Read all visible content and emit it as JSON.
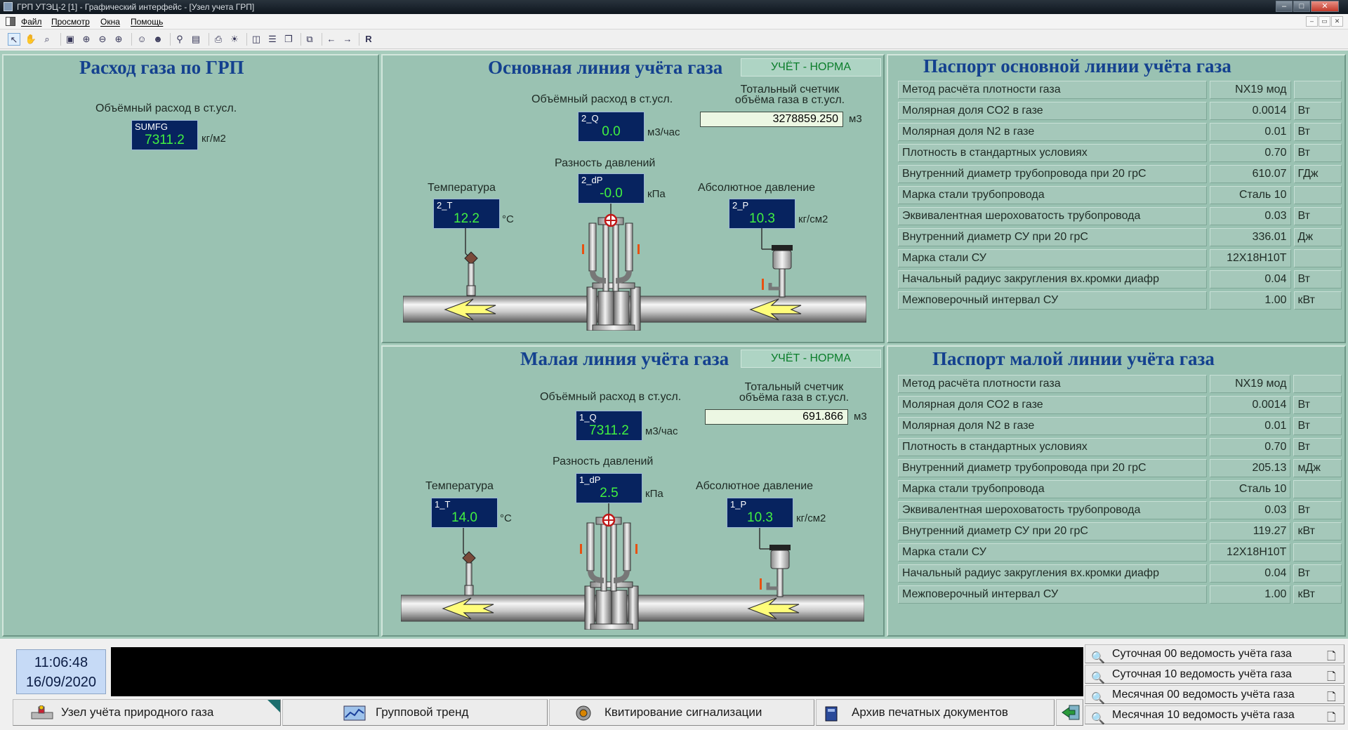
{
  "window": {
    "title": "ГРП УТЭЦ-2 [1] - Графический интерфейс - [Узел учета ГРП]",
    "btn_min": "–",
    "btn_max": "□",
    "btn_close": "✕"
  },
  "menu": {
    "items": [
      "Файл",
      "Просмотр",
      "Окна",
      "Помощь"
    ],
    "mdi_min": "–",
    "mdi_restore": "▭",
    "mdi_close": "✕"
  },
  "toolbar": {
    "r_label": "R"
  },
  "grp": {
    "title": "Расход газа по ГРП",
    "flow_label": "Объёмный расход в ст.усл.",
    "tag_name": "SUMFG",
    "tag_value": "7311.2",
    "unit": "кг/м2"
  },
  "main_line": {
    "title": "Основная линия учёта газа",
    "status": "УЧЁТ - НОРМА",
    "flow_label": "Объёмный расход в ст.усл.",
    "counter_label_1": "Тотальный счетчик",
    "counter_label_2": "объёма газа в ст.усл.",
    "counter_value": "3278859.250",
    "counter_unit": "м3",
    "flow_tag": "2_Q",
    "flow_value": "0.0",
    "flow_unit": "м3/час",
    "dp_label": "Разность давлений",
    "dp_tag": "2_dP",
    "dp_value": "-0.0",
    "dp_unit": "кПа",
    "temp_label": "Температура",
    "temp_tag": "2_T",
    "temp_value": "12.2",
    "temp_unit": "°C",
    "press_label": "Абсолютное давление",
    "press_tag": "2_P",
    "press_value": "10.3",
    "press_unit": "кг/см2"
  },
  "small_line": {
    "title": "Малая линия учёта газа",
    "status": "УЧЁТ - НОРМА",
    "flow_label": "Объёмный расход в ст.усл.",
    "counter_label_1": "Тотальный счетчик",
    "counter_label_2": "объёма газа в ст.усл.",
    "counter_value": "691.866",
    "counter_unit": "м3",
    "flow_tag": "1_Q",
    "flow_value": "7311.2",
    "flow_unit": "м3/час",
    "dp_label": "Разность давлений",
    "dp_tag": "1_dP",
    "dp_value": "2.5",
    "dp_unit": "кПа",
    "temp_label": "Температура",
    "temp_tag": "1_T",
    "temp_value": "14.0",
    "temp_unit": "°C",
    "press_label": "Абсолютное давление",
    "press_tag": "1_P",
    "press_value": "10.3",
    "press_unit": "кг/см2"
  },
  "passport_main": {
    "title": "Паспорт основной линии учёта газа",
    "rows": [
      {
        "name": "Метод расчёта плотности газа",
        "value": "NX19 мод",
        "unit": ""
      },
      {
        "name": "Молярная доля CO2 в газе",
        "value": "0.0014",
        "unit": "Вт"
      },
      {
        "name": "Молярная доля N2 в газе",
        "value": "0.01",
        "unit": "Вт"
      },
      {
        "name": "Плотность в стандартных условиях",
        "value": "0.70",
        "unit": "Вт"
      },
      {
        "name": "Внутренний диаметр трубопровода при 20 грС",
        "value": "610.07",
        "unit": "ГДж"
      },
      {
        "name": "Марка стали трубопровода",
        "value": "Сталь 10",
        "unit": ""
      },
      {
        "name": "Эквивалентная шероховатость трубопровода",
        "value": "0.03",
        "unit": "Вт"
      },
      {
        "name": "Внутренний диаметр СУ при 20 грС",
        "value": "336.01",
        "unit": "Дж"
      },
      {
        "name": "Марка стали СУ",
        "value": "12Х18Н10Т",
        "unit": ""
      },
      {
        "name": "Начальный радиус закругления вх.кромки диафр",
        "value": "0.04",
        "unit": "Вт"
      },
      {
        "name": "Межповерочный интервал СУ",
        "value": "1.00",
        "unit": "кВт"
      }
    ]
  },
  "passport_small": {
    "title": "Паспорт малой линии учёта газа",
    "rows": [
      {
        "name": "Метод расчёта плотности газа",
        "value": "NX19 мод",
        "unit": ""
      },
      {
        "name": "Молярная доля CO2 в газе",
        "value": "0.0014",
        "unit": "Вт"
      },
      {
        "name": "Молярная доля N2 в газе",
        "value": "0.01",
        "unit": "Вт"
      },
      {
        "name": "Плотность в стандартных условиях",
        "value": "0.70",
        "unit": "Вт"
      },
      {
        "name": "Внутренний диаметр трубопровода при 20 грС",
        "value": "205.13",
        "unit": "мДж"
      },
      {
        "name": "Марка стали трубопровода",
        "value": "Сталь 10",
        "unit": ""
      },
      {
        "name": "Эквивалентная шероховатость трубопровода",
        "value": "0.03",
        "unit": "Вт"
      },
      {
        "name": "Внутренний диаметр СУ при 20 грС",
        "value": "119.27",
        "unit": "кВт"
      },
      {
        "name": "Марка стали СУ",
        "value": "12Х18Н10Т",
        "unit": ""
      },
      {
        "name": "Начальный радиус закругления вх.кромки диафр",
        "value": "0.04",
        "unit": "Вт"
      },
      {
        "name": "Межповерочный интервал СУ",
        "value": "1.00",
        "unit": "кВт"
      }
    ]
  },
  "clock": {
    "time": "11:06:48",
    "date": "16/09/2020"
  },
  "nav": {
    "node": "Узел учёта природного газа",
    "trend": "Групповой тренд",
    "ack": "Квитирование сигнализации",
    "archive": "Архив печатных документов"
  },
  "reports": [
    "Суточная 00 ведомость учёта газа",
    "Суточная 10 ведомость учёта газа",
    "Месячная 00 ведомость учёта газа",
    "Месячная 10 ведомость учёта газа"
  ],
  "colors": {
    "background": "#a6ccbc",
    "panel": "#9ac2b2",
    "title": "#14418f",
    "tag_bg": "#07235f",
    "tag_value": "#41f041",
    "status_text": "#0a7d2a"
  }
}
